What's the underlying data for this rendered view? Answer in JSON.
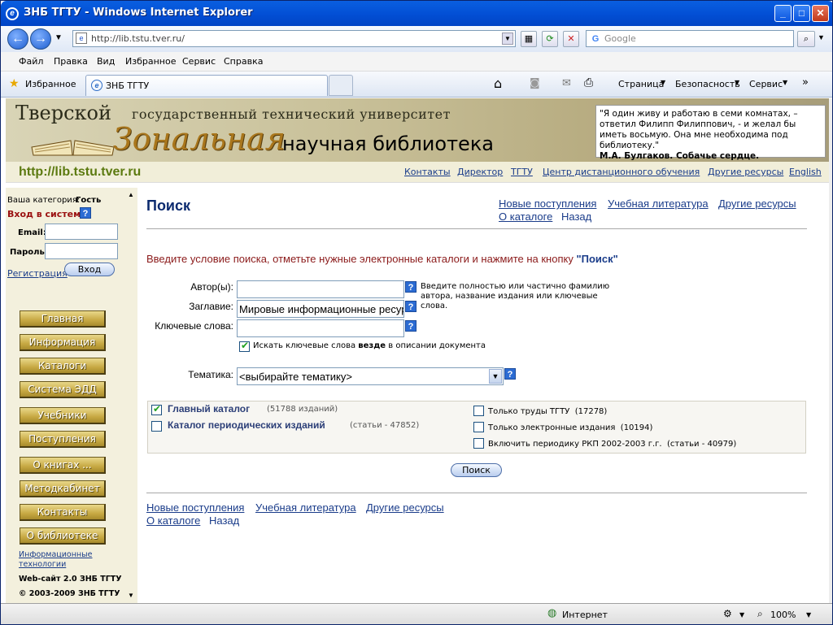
{
  "browser": {
    "title": "ЗНБ ТГТУ - Windows Internet Explorer",
    "address": "http://lib.tstu.tver.ru/",
    "search_placeholder": "Google",
    "menu": [
      "Файл",
      "Правка",
      "Вид",
      "Избранное",
      "Сервис",
      "Справка"
    ],
    "favorites_label": "Избранное",
    "tab_label": "ЗНБ ТГТУ",
    "toolbar": {
      "page": "Страница",
      "safety": "Безопасность",
      "service": "Сервис"
    }
  },
  "banner": {
    "university": "Тверской",
    "university_rest": "государственный технический университет",
    "zonal": "Зональная",
    "library": "научная библиотека",
    "quote_text": "\"Я один живу и работаю в семи комнатах, – ответил Филипп Филиппович, - и желал бы иметь восьмую. Она мне необходима под библиотеку.\"",
    "quote_author": "М.А. Булгаков. Собачье сердце."
  },
  "urlbar": {
    "url": "http://lib.tstu.tver.ru",
    "links": [
      "Контакты",
      "Директор",
      "ТГТУ",
      "Центр дистанционного обучения",
      "Другие ресурсы",
      "English"
    ]
  },
  "sidebar": {
    "category_label": "Ваша категория:",
    "category_value": "Гость",
    "login_title": "Вход в систему",
    "email_label": "Email:",
    "password_label": "Пароль:",
    "register": "Регистрация",
    "login_button": "Вход",
    "nav": [
      "Главная",
      "Информация",
      "Каталоги",
      "Система ЭДД",
      "Учебники",
      "Поступления",
      "О книгах ...",
      "Методкабинет",
      "Контакты",
      "О библиотеке"
    ],
    "footer_link": "Информационные технологии",
    "footer_site": "Web-сайт 2.0 ЗНБ ТГТУ",
    "footer_copy": "© 2003-2009 ЗНБ ТГТУ"
  },
  "main": {
    "title": "Поиск",
    "header_links": [
      "Новые поступления",
      "Учебная литература",
      "Другие ресурсы",
      "О каталоге",
      "Назад"
    ],
    "instruction": "Введите условие поиска, отметьте нужные электронные каталоги и нажмите на кнопку",
    "instruction_bold": "\"Поиск\"",
    "fields": {
      "author_label": "Автор(ы):",
      "author_value": "",
      "title_label": "Заглавие:",
      "title_value": "Мировые информационные ресурсы",
      "keywords_label": "Ключевые слова:",
      "keywords_value": ""
    },
    "hint": "Введите полностью или частично фамилию автора, название издания или ключевые слова.",
    "search_everywhere": "Искать ключевые слова",
    "search_everywhere_bold": "везде",
    "search_everywhere_tail": "в описании документа",
    "theme_label": "Тематика:",
    "theme_value": "<выбирайте тематику>",
    "catalogs": [
      {
        "name": "Главный каталог",
        "count": "(51788 изданий)",
        "checked": true
      },
      {
        "name": "Каталог периодических изданий",
        "count": "(статьи - 47852)",
        "checked": false
      }
    ],
    "filters": [
      {
        "label": "Только труды ТГТУ",
        "count": "(17278)"
      },
      {
        "label": "Только электронные издания",
        "count": "(10194)"
      },
      {
        "label": "Включить периодику РКП 2002-2003 г.г.",
        "count": "(статьи - 40979)"
      }
    ],
    "search_button": "Поиск",
    "footer_links": [
      "Новые поступления",
      "Учебная литература",
      "Другие ресурсы",
      "О каталоге",
      "Назад"
    ]
  },
  "status": {
    "zone": "Интернет",
    "zoom": "100%"
  }
}
